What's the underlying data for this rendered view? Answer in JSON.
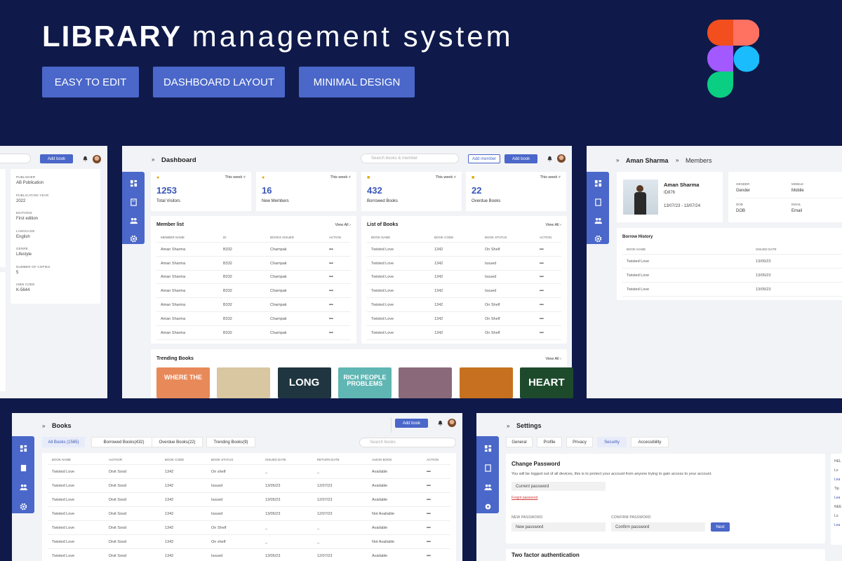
{
  "hero": {
    "title_bold": "LIBRARY",
    "title_rest": "management system",
    "pills": [
      "EASY TO EDIT",
      "DASHBOARD LAYOUT",
      "MINIMAL DESIGN"
    ]
  },
  "colors": {
    "navy": "#0f1a4a",
    "accent": "#4a67c9",
    "panel": "#f2f3f7"
  },
  "left_panel": {
    "add_button": "Add book",
    "fields": [
      {
        "label": "PUBLISHER",
        "value": "AB Publication"
      },
      {
        "label": "PUBLICATION YEAR",
        "value": "2022"
      },
      {
        "label": "EDITIONS",
        "value": "First edition"
      },
      {
        "label": "LANGUAGE",
        "value": "English"
      },
      {
        "label": "GENRE",
        "value": "Lifestyle"
      },
      {
        "label": "NUMBER OF COPIES",
        "value": "5"
      },
      {
        "label": "ISBN CODE",
        "value": "K-5644"
      }
    ]
  },
  "dashboard": {
    "breadcrumb_chevron": "»",
    "title": "Dashboard",
    "search_placeholder": "Search books & member",
    "add_member": "Add member",
    "add_book": "Add book",
    "stats": [
      {
        "value": "1253",
        "label": "Total Visitors",
        "period": "This week"
      },
      {
        "value": "16",
        "label": "New Members",
        "period": "This week"
      },
      {
        "value": "432",
        "label": "Borrowed Books",
        "period": "This week"
      },
      {
        "value": "22",
        "label": "Overdue Books",
        "period": "This week"
      }
    ],
    "member_list": {
      "title": "Member list",
      "view_all": "View All",
      "headers": [
        "MEMBER NAME",
        "ID",
        "BOOKS ISSUED",
        "ACTION"
      ],
      "rows": [
        [
          "Aman Sharma",
          "B332",
          "Champak",
          "•••"
        ],
        [
          "Aman Sharma",
          "B332",
          "Champak",
          "•••"
        ],
        [
          "Aman Sharma",
          "B332",
          "Champak",
          "•••"
        ],
        [
          "Aman Sharma",
          "B332",
          "Champak",
          "•••"
        ],
        [
          "Aman Sharma",
          "B332",
          "Champak",
          "•••"
        ],
        [
          "Aman Sharma",
          "B332",
          "Champak",
          "•••"
        ],
        [
          "Aman Sharma",
          "B332",
          "Champak",
          "•••"
        ]
      ]
    },
    "book_list": {
      "title": "List of Books",
      "view_all": "View All",
      "headers": [
        "BOOK NAME",
        "BOOK CODE",
        "BOOK STATUS",
        "ACTION"
      ],
      "rows": [
        [
          "Twisted Love",
          "1342",
          "On Shelf",
          "•••"
        ],
        [
          "Twisted Love",
          "1342",
          "Issued",
          "•••"
        ],
        [
          "Twisted Love",
          "1342",
          "Issued",
          "•••"
        ],
        [
          "Twisted Love",
          "1342",
          "Issued",
          "•••"
        ],
        [
          "Twisted Love",
          "1342",
          "On Shelf",
          "•••"
        ],
        [
          "Twisted Love",
          "1342",
          "On Shelf",
          "•••"
        ],
        [
          "Twisted Love",
          "1342",
          "On Shelf",
          "•••"
        ]
      ]
    },
    "trending": {
      "title": "Trending Books",
      "view_all": "View All",
      "books": [
        {
          "text": "WHERE THE",
          "bg": "#e8895a"
        },
        {
          "text": "",
          "bg": "#d9c7a2"
        },
        {
          "text": "LONG",
          "bg": "#1f3540"
        },
        {
          "text": "RICH PEOPLE PROBLEMS",
          "bg": "#5fb6b3"
        },
        {
          "text": "",
          "bg": "#8a6a7a"
        },
        {
          "text": "",
          "bg": "#c7701f"
        },
        {
          "text": "HEART",
          "bg": "#1e4a2c"
        }
      ]
    }
  },
  "member_profile": {
    "name_crumb": "Aman Sharma",
    "section": "Members",
    "name": "Aman Sharma",
    "id": "ID876",
    "dates": "13/07/23 - 13/07/24",
    "fields": [
      {
        "label": "GENDER",
        "value": "Gender"
      },
      {
        "label": "MOBILE",
        "value": "Mobile"
      },
      {
        "label": "DOB",
        "value": "DOB"
      },
      {
        "label": "EMAIL",
        "value": "Email"
      }
    ],
    "borrow": {
      "title": "Borrow History",
      "headers": [
        "BOOK NAME",
        "ISSUED DATE"
      ],
      "rows": [
        [
          "Twisted Love",
          "13/05/23"
        ],
        [
          "Twisted Love",
          "13/05/23"
        ],
        [
          "Twisted Love",
          "13/05/23"
        ]
      ]
    }
  },
  "books": {
    "title": "Books",
    "add_book": "Add book",
    "search_placeholder": "Search books",
    "tabs": [
      "All Books (1565)",
      "Borrowed Books(432)",
      "Overdue Books(22)",
      "Trending Books(9)"
    ],
    "headers": [
      "BOOK NAME",
      "AUTHOR",
      "BOOK CODE",
      "BOOK STATUS",
      "ISSUED DATE",
      "RETURN DATE",
      "AUDIO BOOK",
      "ACTION"
    ],
    "rows": [
      [
        "Twisted Love",
        "Divit Sood",
        "1342",
        "On shelf",
        "_",
        "_",
        "Available",
        "•••"
      ],
      [
        "Twisted Love",
        "Divit Sood",
        "1342",
        "Issued",
        "13/05/23",
        "12/07/23",
        "Available",
        "•••"
      ],
      [
        "Twisted Love",
        "Divit Sood",
        "1342",
        "Issued",
        "13/05/23",
        "12/07/23",
        "Available",
        "•••"
      ],
      [
        "Twisted Love",
        "Divit Sood",
        "1342",
        "Issued",
        "13/05/23",
        "12/07/23",
        "Not Available",
        "•••"
      ],
      [
        "Twisted Love",
        "Divit Sood",
        "1342",
        "On Shelf",
        "_",
        "_",
        "Available",
        "•••"
      ],
      [
        "Twisted Love",
        "Divit Sood",
        "1342",
        "On shelf",
        "_",
        "_",
        "Not Available",
        "•••"
      ],
      [
        "Twisted Love",
        "Divit Sood",
        "1342",
        "Issued",
        "13/05/23",
        "12/07/23",
        "Available",
        "•••"
      ]
    ]
  },
  "settings": {
    "title": "Settings",
    "tabs": [
      "General",
      "Profile",
      "Privacy",
      "Security",
      "Accessibility"
    ],
    "change_password": "Change Password",
    "notice": "You will be logged out of all devices, this is to protect your account from anyone trying to gain access to your account.",
    "current_password": "Current password",
    "forgot": "Forgot password",
    "new_label": "NEW PASSWORD",
    "confirm_label": "CONFIRM PASSWORD",
    "new_placeholder": "New password",
    "confirm_placeholder": "Confirm password",
    "next": "Next",
    "two_factor": "Two factor authentication",
    "side_snippets": [
      "HEL",
      "Lo",
      "Lea",
      "Tip",
      "Lea",
      "NEE",
      "Lo",
      "Lea"
    ]
  }
}
